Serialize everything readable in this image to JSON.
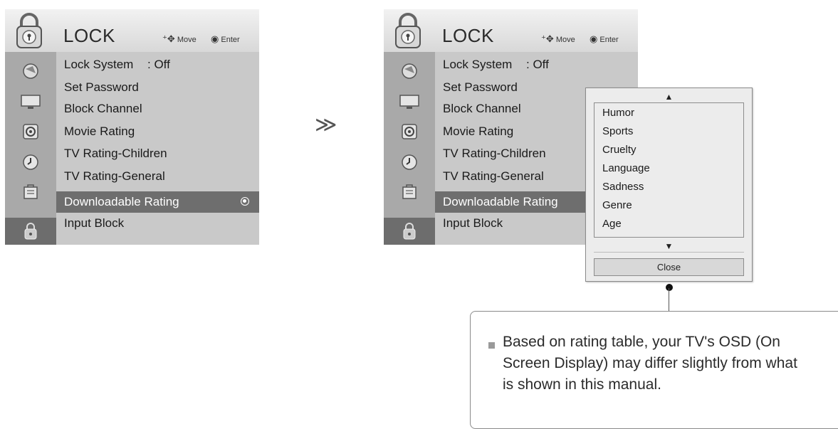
{
  "menu": {
    "title": "LOCK",
    "hint_move": "Move",
    "hint_enter": "Enter",
    "items": [
      {
        "label": "Lock System",
        "value": ": Off"
      },
      {
        "label": "Set Password"
      },
      {
        "label": "Block Channel"
      },
      {
        "label": "Movie Rating"
      },
      {
        "label": "TV Rating-Children"
      },
      {
        "label": "TV Rating-General"
      },
      {
        "label": "Downloadable Rating"
      },
      {
        "label": "Input Block"
      }
    ],
    "selected_item": "Downloadable Rating",
    "rail_icons": [
      "picture-icon",
      "screen-icon",
      "speaker-icon",
      "clock-icon",
      "option-icon",
      "lock-icon"
    ],
    "active_rail_icon": "lock-icon"
  },
  "separator": "≫",
  "popup": {
    "options": [
      "Humor",
      "Sports",
      "Cruelty",
      "Language",
      "Sadness",
      "Genre",
      "Age"
    ],
    "close_label": "Close"
  },
  "note": {
    "text": "Based on rating table, your TV's OSD (On Screen Display) may differ slightly from what is shown in this manual."
  },
  "colors": {
    "menu_bg": "#c9c9c9",
    "rail_bg": "#a9a9a9",
    "selected_bg": "#6e6e6e"
  }
}
